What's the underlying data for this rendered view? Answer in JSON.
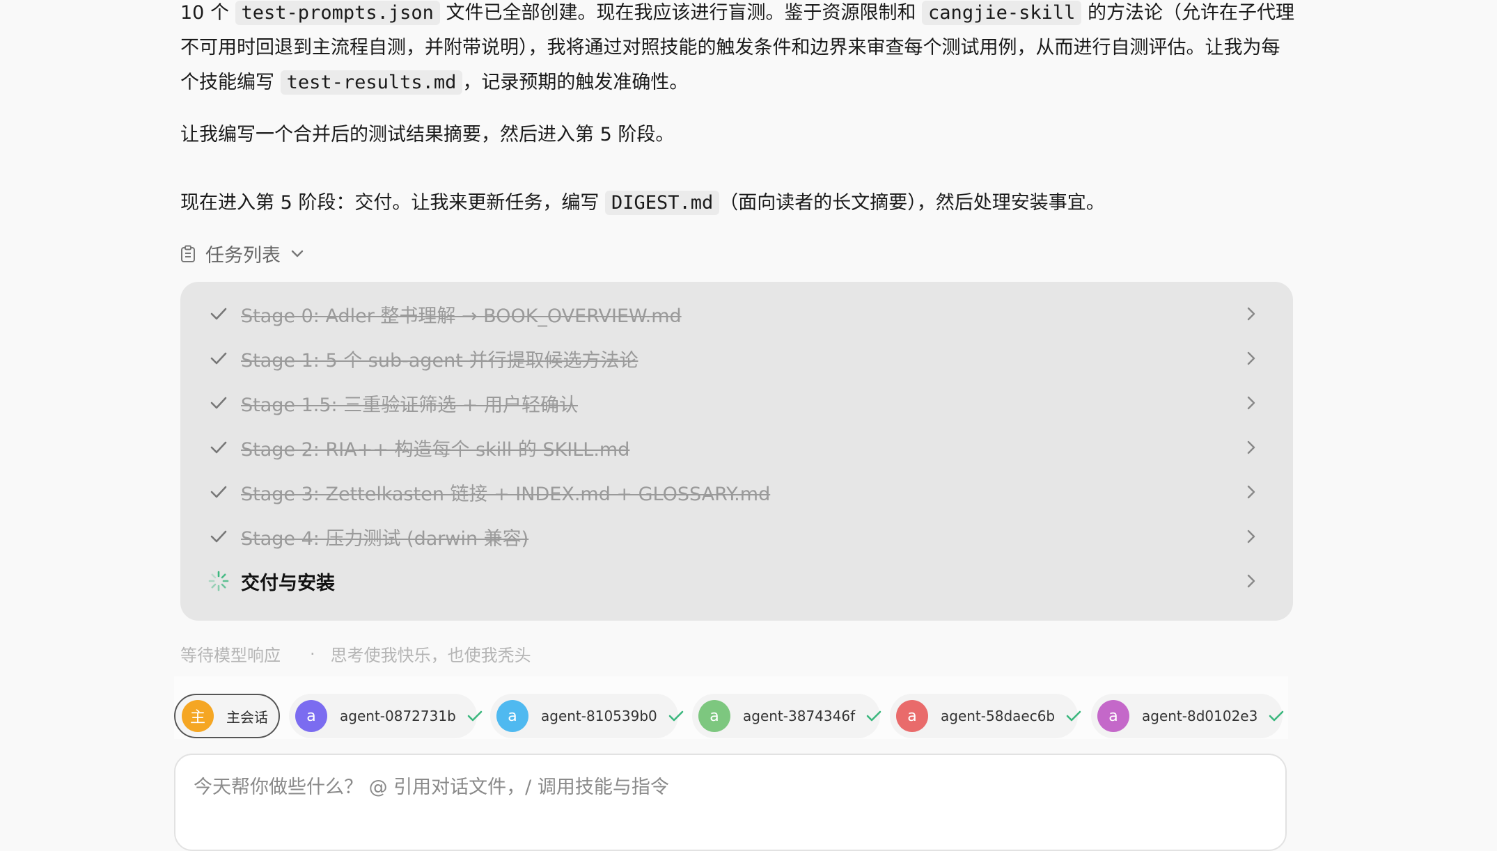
{
  "messages": {
    "p1": {
      "t1": "10 个 ",
      "c1": "test-prompts.json",
      "t2": " 文件已全部创建。现在我应该进行盲测。鉴于资源限制和 ",
      "c2": "cangjie-skill",
      "t3": " 的方法论（允许在子代理不可用时回退到主流程自测，并附带说明），我将通过对照技能的触发条件和边界来审查每个测试用例，从而进行自测评估。让我为每个技能编写 ",
      "c3": "test-results.md",
      "t4": "，记录预期的触发准确性。"
    },
    "p2": "让我编写一个合并后的测试结果摘要，然后进入第 5 阶段。",
    "p3": {
      "t1": "现在进入第 5 阶段：交付。让我来更新任务，编写 ",
      "c1": "DIGEST.md",
      "t2": "（面向读者的长文摘要），然后处理安装事宜。"
    }
  },
  "tasklist": {
    "title": "任务列表",
    "items": [
      {
        "label": "Stage 0: Adler 整书理解 → BOOK_OVERVIEW.md",
        "status": "done"
      },
      {
        "label": "Stage 1: 5 个 sub-agent 并行提取候选方法论",
        "status": "done"
      },
      {
        "label": "Stage 1.5: 三重验证筛选 + 用户轻确认",
        "status": "done"
      },
      {
        "label": "Stage 2: RIA++ 构造每个 skill 的 SKILL.md",
        "status": "done"
      },
      {
        "label": "Stage 3: Zettelkasten 链接 + INDEX.md + GLOSSARY.md",
        "status": "done"
      },
      {
        "label": "Stage 4: 压力测试 (darwin 兼容)",
        "status": "done"
      },
      {
        "label": "交付与安装",
        "status": "in_progress"
      }
    ]
  },
  "status": {
    "waiting": "等待模型响应",
    "quote": "思考使我快乐，也使我秃头"
  },
  "agents": [
    {
      "avatar": "主",
      "label": "主会话",
      "color": "#f5a623",
      "selected": true,
      "check": false
    },
    {
      "avatar": "a",
      "label": "agent-0872731b",
      "color": "#7b6cf0",
      "selected": false,
      "check": true
    },
    {
      "avatar": "a",
      "label": "agent-810539b0",
      "color": "#4fb9f0",
      "selected": false,
      "check": true
    },
    {
      "avatar": "a",
      "label": "agent-3874346f",
      "color": "#7dc77f",
      "selected": false,
      "check": true
    },
    {
      "avatar": "a",
      "label": "agent-58daec6b",
      "color": "#e96b6b",
      "selected": false,
      "check": true
    },
    {
      "avatar": "a",
      "label": "agent-8d0102e3",
      "color": "#c468c9",
      "selected": false,
      "check": true
    }
  ],
  "input": {
    "placeholder": "今天帮你做些什么？ @ 引用对话文件，/ 调用技能与指令",
    "value": ""
  },
  "colors": {
    "check": "#3bb77e",
    "spinner": "#3bb77e"
  }
}
